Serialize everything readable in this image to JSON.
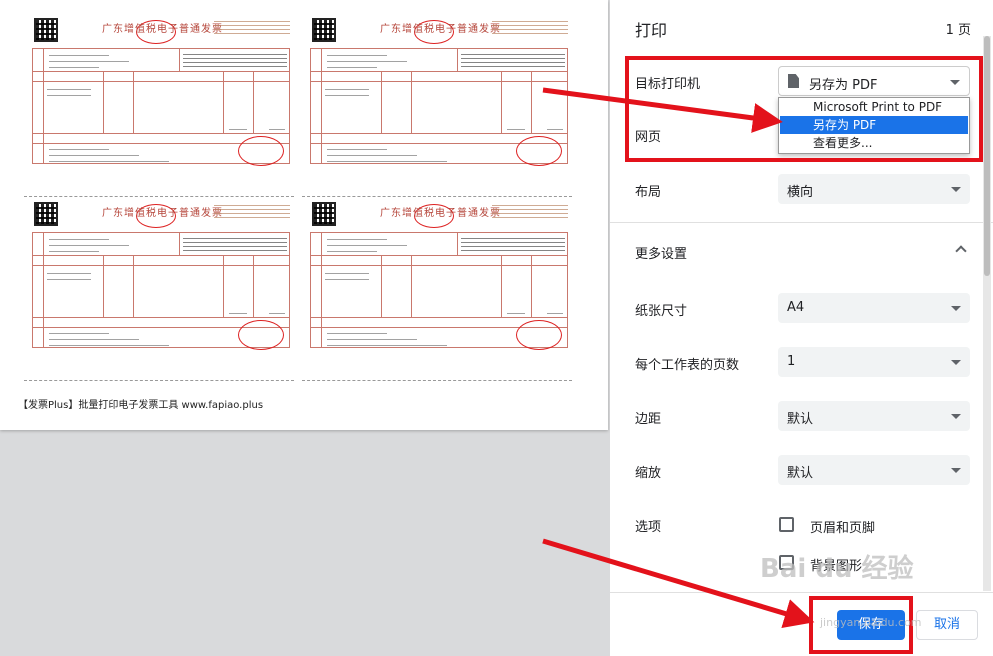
{
  "preview": {
    "invoice_title": "广东增值税电子普通发票",
    "invoice_count": 4,
    "footer_note": "【发票Plus】批量打印电子发票工具 www.fapiao.plus"
  },
  "panel": {
    "title": "打印",
    "page_count": "1 页",
    "destination": {
      "label": "目标打印机",
      "value": "另存为 PDF",
      "icon": "pdf-file-icon",
      "options": [
        "Microsoft Print to PDF",
        "另存为 PDF",
        "查看更多..."
      ],
      "selected_index": 1
    },
    "pages": {
      "label": "网页"
    },
    "layout": {
      "label": "布局",
      "value": "横向"
    },
    "more_settings": {
      "label": "更多设置",
      "expanded": true
    },
    "paper_size": {
      "label": "纸张尺寸",
      "value": "A4"
    },
    "pages_per_sheet": {
      "label": "每个工作表的页数",
      "value": "1"
    },
    "margins": {
      "label": "边距",
      "value": "默认"
    },
    "scale": {
      "label": "缩放",
      "value": "默认"
    },
    "options": {
      "label": "选项",
      "headers_footers": {
        "label": "页眉和页脚",
        "checked": false
      },
      "background_graphics": {
        "label": "背景图形",
        "checked": false
      }
    },
    "buttons": {
      "print": "保存",
      "cancel": "取消"
    }
  },
  "annotation": {
    "color": "#e3121b"
  },
  "watermark": {
    "brand": "Bai du 经验",
    "url": "jingyan.baidu.com"
  },
  "colors": {
    "accent": "#1a73e8",
    "invoice_red": "#c9786d"
  }
}
